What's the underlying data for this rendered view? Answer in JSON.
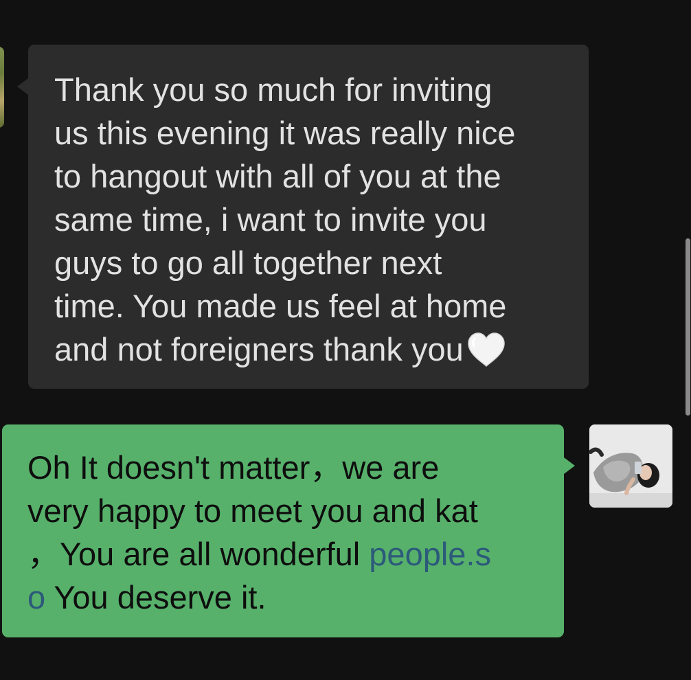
{
  "conversation": {
    "incoming": {
      "lines": [
        "Thank you so much for inviting",
        "us this evening it was really nice",
        "to hangout with all of you at the",
        "same time, i want to invite you",
        "guys to go all together next",
        "time. You made us feel at home",
        "and not foreigners thank you"
      ],
      "emoji": "white-heart-icon",
      "bubble_color": "#2c2c2c",
      "text_color": "#e2e2e2"
    },
    "outgoing": {
      "line1": "Oh It doesn't matter，we are",
      "line2": "very happy to meet you and kat",
      "line3_prefix": "，You are all wonderful ",
      "link_text_a": "people.s",
      "link_text_b": "o",
      "line4_suffix": " You deserve it.",
      "bubble_color": "#57b16b",
      "link_color": "#2c5a7a"
    }
  },
  "theme": {
    "background": "#111111"
  }
}
